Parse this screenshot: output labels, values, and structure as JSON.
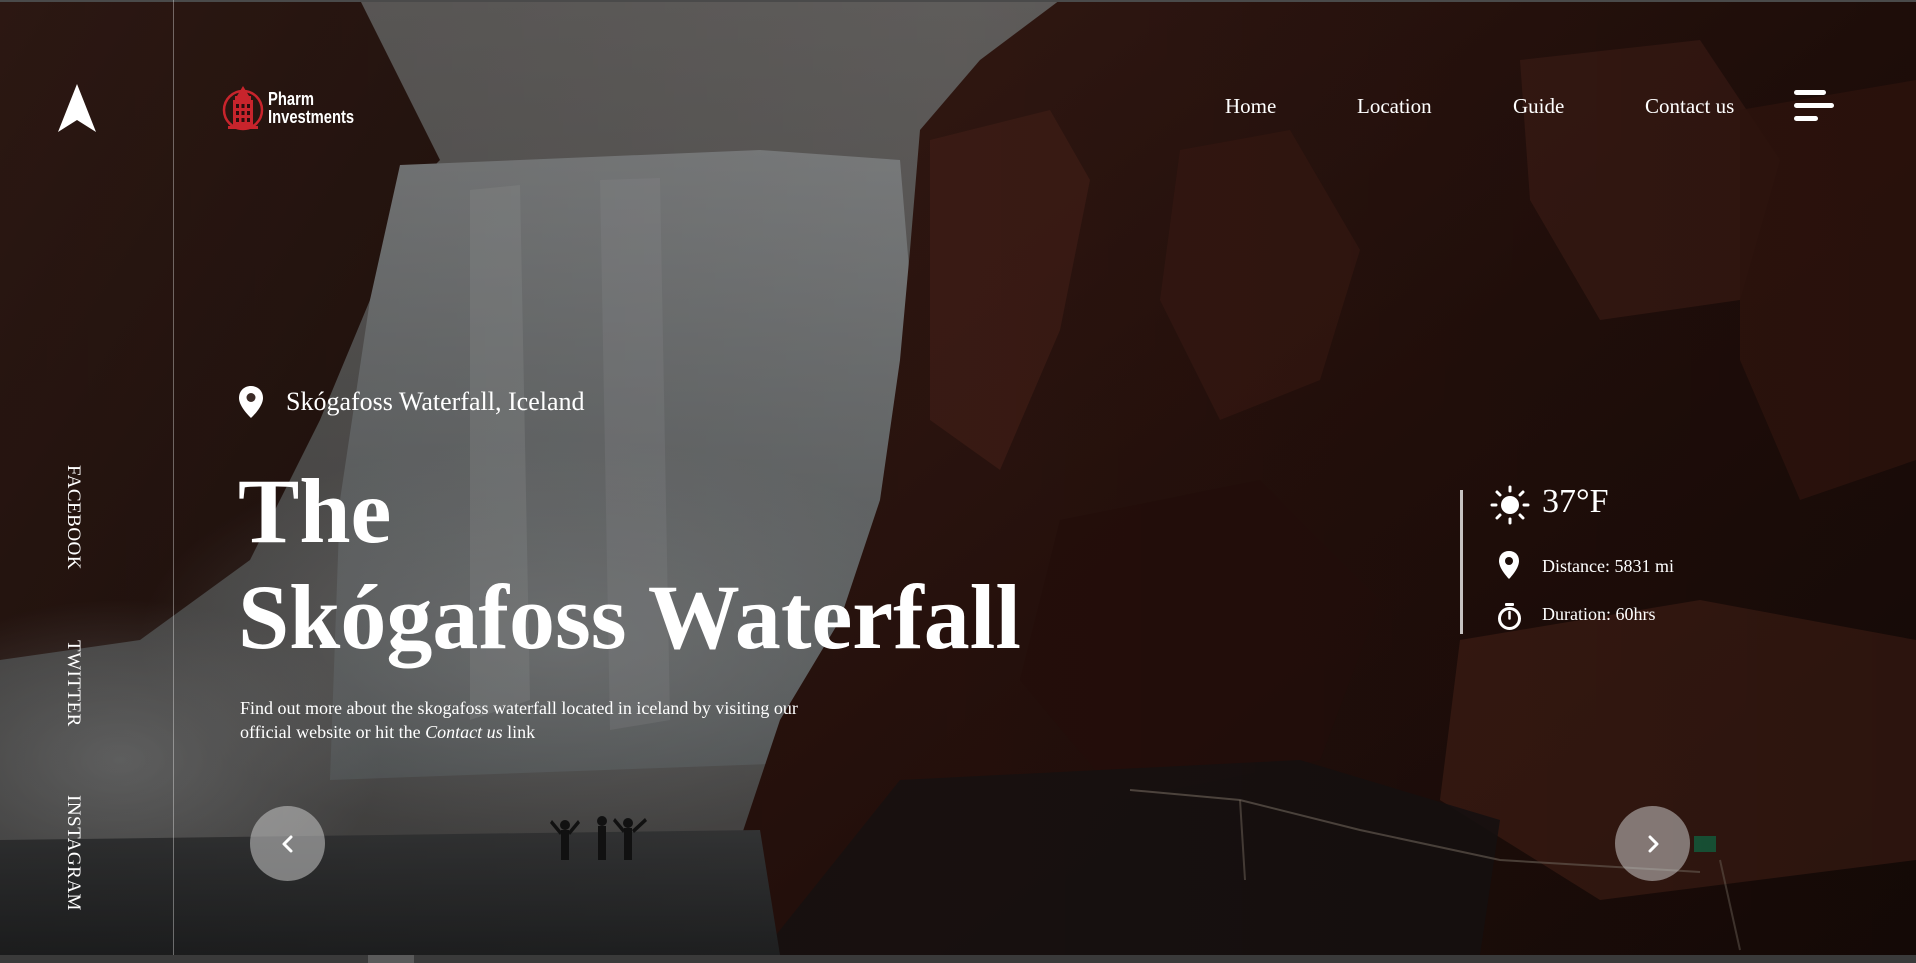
{
  "brand": {
    "name_line1": "Pharm",
    "name_line2": "Investments"
  },
  "nav": {
    "items": [
      {
        "label": "Home"
      },
      {
        "label": "Location"
      },
      {
        "label": "Guide"
      },
      {
        "label": "Contact us"
      }
    ],
    "menu_icon": "hamburger-menu-icon"
  },
  "social": {
    "items": [
      {
        "label": "FACEBOOK"
      },
      {
        "label": "TWITTER"
      },
      {
        "label": "INSTAGRAM"
      }
    ]
  },
  "hero": {
    "location": "Skógafoss Waterfall, Iceland",
    "title_line1": "The",
    "title_line2": "Skógafoss Waterfall",
    "description_part1": "Find out more about the skogafoss waterfall located in iceland by visiting our official website or hit the ",
    "description_link": "Contact us",
    "description_part2": " link"
  },
  "stats": {
    "temperature": "37°F",
    "distance": "Distance: 5831 mi",
    "duration": "Duration: 60hrs"
  },
  "controls": {
    "prev_icon": "chevron-left-icon",
    "next_icon": "chevron-right-icon"
  },
  "colors": {
    "text": "#ffffff",
    "rock": "#5a2418",
    "mist": "#8a8a8a",
    "logo_red": "#c8242c"
  }
}
